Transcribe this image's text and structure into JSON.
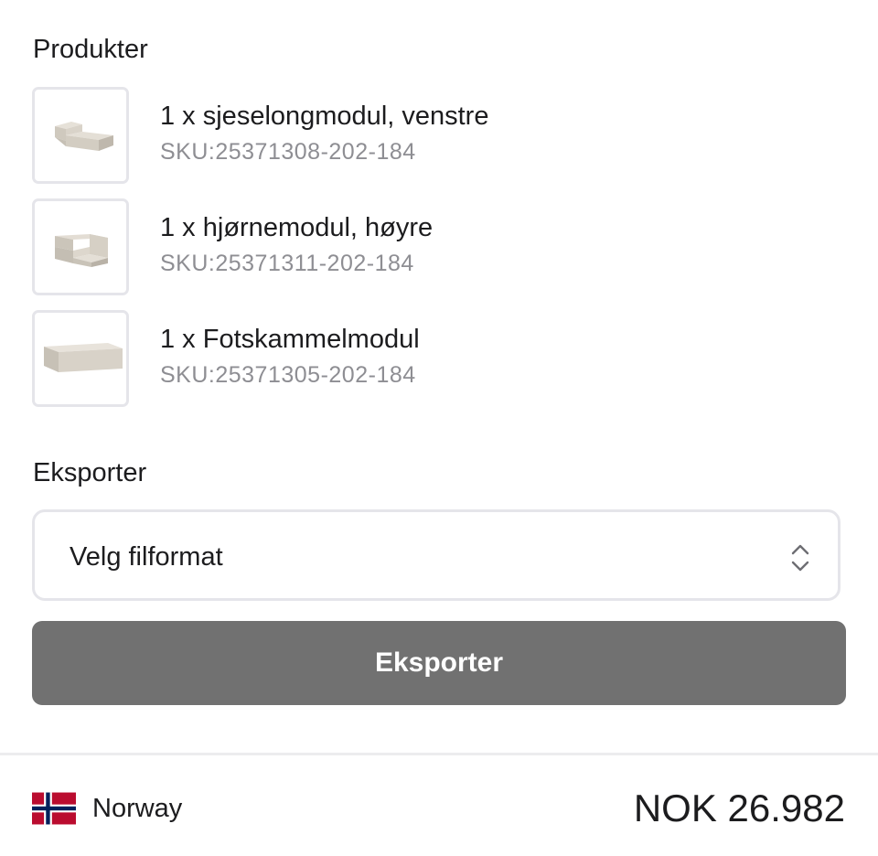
{
  "products": {
    "title": "Produkter",
    "items": [
      {
        "name": "1 x sjeselongmodul, venstre",
        "sku": "SKU:25371308-202-184",
        "icon": "chaise-module-image"
      },
      {
        "name": "1 x hjørnemodul, høyre",
        "sku": "SKU:25371311-202-184",
        "icon": "corner-module-image"
      },
      {
        "name": "1 x Fotskammelmodul",
        "sku": "SKU:25371305-202-184",
        "icon": "footstool-module-image"
      }
    ]
  },
  "export": {
    "title": "Eksporter",
    "select_value": "Velg filformat",
    "button_label": "Eksporter"
  },
  "footer": {
    "country": "Norway",
    "price": "NOK 26.982"
  },
  "colors": {
    "button_bg": "#717171",
    "border": "#e5e5ea",
    "sku_text": "#8e8e93",
    "flag_red": "#ba0c2f",
    "flag_blue": "#00205b"
  }
}
